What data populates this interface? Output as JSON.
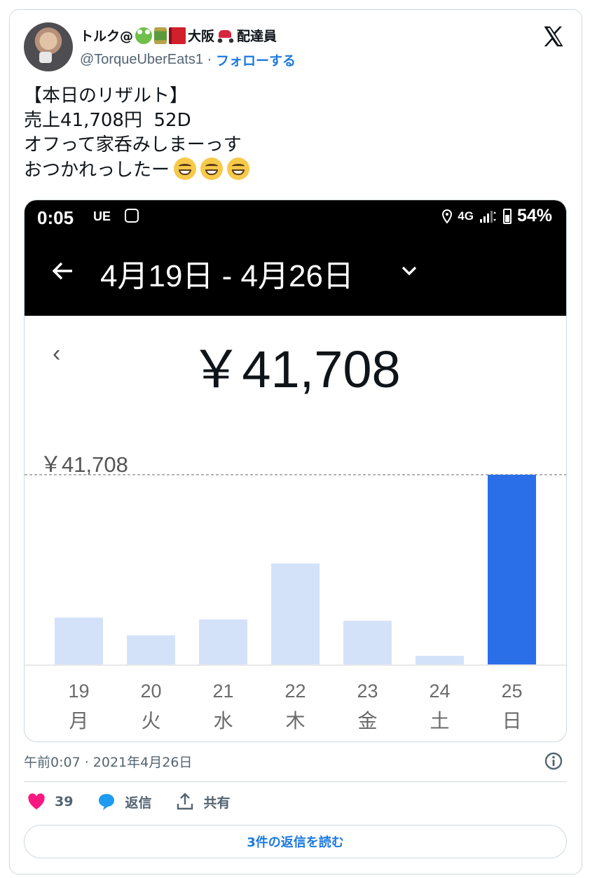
{
  "author": {
    "display_name": "トルク@",
    "name_suffix": "大阪",
    "name_suffix2": "配達員",
    "handle": "@TorqueUberEats1",
    "separator": "·",
    "follow_label": "フォローする",
    "emoji_icons": [
      "frog-icon",
      "canned-drink-icon",
      "red-book-icon",
      "scooter-icon"
    ]
  },
  "tweet": {
    "lines": [
      "【本日のリザルト】",
      "売上41,708円  52D",
      "オフって家呑みしまーっす",
      "おつかれっしたー"
    ],
    "trailing_emoji": "grinning-face-icon",
    "trailing_emoji_count": 3
  },
  "screenshot": {
    "status_bar": {
      "time": "0:05",
      "carrier": "UE",
      "network": "4G",
      "battery": "54%"
    },
    "date_range": "4月19日 - 4月26日",
    "total": "￥41,708",
    "max_label": "￥41,708",
    "accent_color": "#2a6fe8",
    "light_bar_color": "#d4e2f9"
  },
  "chart_data": {
    "type": "bar",
    "categories": [
      "19",
      "20",
      "21",
      "22",
      "23",
      "24",
      "25"
    ],
    "weekdays": [
      "月",
      "火",
      "水",
      "木",
      "金",
      "土",
      "日"
    ],
    "values": [
      10300,
      6400,
      9900,
      22200,
      9600,
      1900,
      41708
    ],
    "ylim": [
      0,
      41708
    ],
    "highlight_index": 6,
    "reference_line": 41708
  },
  "footer": {
    "timestamp": "午前0:07 · 2021年4月26日",
    "likes": "39",
    "reply_label": "返信",
    "share_label": "共有",
    "read_replies": "3件の返信を読む"
  }
}
